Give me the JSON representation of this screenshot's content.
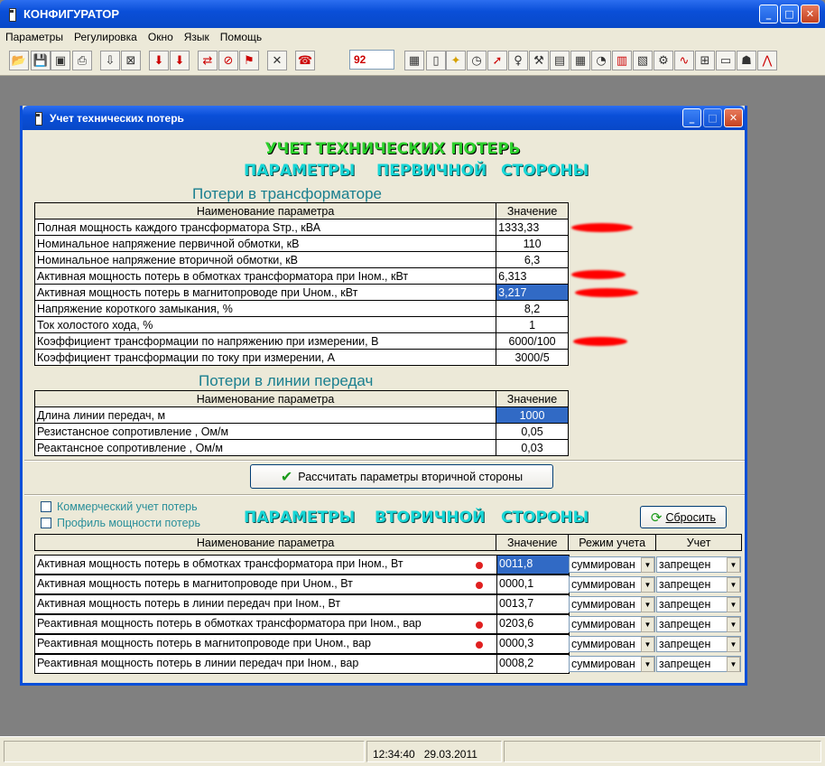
{
  "app": {
    "title": "КОНФИГУРАТОР"
  },
  "menu": [
    "Параметры",
    "Регулировка",
    "Окно",
    "Язык",
    "Помощь"
  ],
  "toolbar": {
    "number": "92"
  },
  "dialog": {
    "title": "Учет технических потерь",
    "heading": "УЧЕТ ТЕХНИЧЕСКИХ ПОТЕРЬ",
    "primary_heading": [
      "ПАРАМЕТРЫ",
      "ПЕРВИЧНОЙ",
      "СТОРОНЫ"
    ],
    "secondary_heading": [
      "ПАРАМЕТРЫ",
      "ВТОРИЧНОЙ",
      "СТОРОНЫ"
    ],
    "transformer_section": "Потери в трансформаторе",
    "line_section": "Потери в линии передач",
    "col_name": "Наименование параметра",
    "col_value": "Значение",
    "col_mode": "Режим учета",
    "col_account": "Учет",
    "transformer_rows": [
      {
        "name": "Полная мощность каждого трансформатора Sтр., кВА",
        "value": "1333,33"
      },
      {
        "name": "Номинальное напряжение первичной обмотки, кВ",
        "value": "110"
      },
      {
        "name": "Номинальное напряжение вторичной обмотки, кВ",
        "value": "6,3"
      },
      {
        "name": "Активная мощность потерь в обмотках трансформатора при Iном., кВт",
        "value": "6,313"
      },
      {
        "name": "Активная мощность потерь в магнитопроводе при Uном., кВт",
        "value": "3,217"
      },
      {
        "name": "Напряжение короткого замыкания, %",
        "value": "8,2"
      },
      {
        "name": "Ток холостого хода, %",
        "value": "1"
      },
      {
        "name": "Коэффициент трансформации по напряжению при измерении, В",
        "value": "6000/100"
      },
      {
        "name": "Коэффициент трансформации по току при измерении, А",
        "value": "3000/5"
      }
    ],
    "line_rows": [
      {
        "name": "Длина линии передач, м",
        "value": "1000"
      },
      {
        "name": "Резистансное сопротивление , Ом/м",
        "value": "0,05"
      },
      {
        "name": "Реактансное сопротивление , Ом/м",
        "value": "0,03"
      }
    ],
    "calc_button": "Рассчитать параметры вторичной стороны",
    "checkbox_commercial": "Коммерческий учет потерь",
    "checkbox_profile": "Профиль мощности потерь",
    "reset_button": "Сбросить",
    "secondary_rows": [
      {
        "name": "Активная мощность потерь в обмотках трансформатора при Iном., Вт",
        "value": "0011,8",
        "mode": "суммирован",
        "account": "запрещен"
      },
      {
        "name": "Активная мощность потерь в магнитопроводе при Uном., Вт",
        "value": "0000,1",
        "mode": "суммирован",
        "account": "запрещен"
      },
      {
        "name": "Активная мощность потерь в линии передач при Iном., Вт",
        "value": "0013,7",
        "mode": "суммирован",
        "account": "запрещен"
      },
      {
        "name": "Реактивная мощность потерь в обмотках трансформатора при Iном., вар",
        "value": "0203,6",
        "mode": "суммирован",
        "account": "запрещен"
      },
      {
        "name": "Реактивная мощность потерь в магнитопроводе при Uном., вар",
        "value": "0000,3",
        "mode": "суммирован",
        "account": "запрещен"
      },
      {
        "name": "Реактивная мощность потерь в линии передач при Iном., вар",
        "value": "0008,2",
        "mode": "суммирован",
        "account": "запрещен"
      }
    ]
  },
  "status": {
    "time": "12:34:40",
    "date": "29.03.2011"
  },
  "colors": {
    "titlebar": "#0a4fd8",
    "heading_green": "#2cd02c",
    "heading_cyan": "#17d6d6",
    "selection": "#316ac5",
    "marker_red": "#ff0000"
  }
}
